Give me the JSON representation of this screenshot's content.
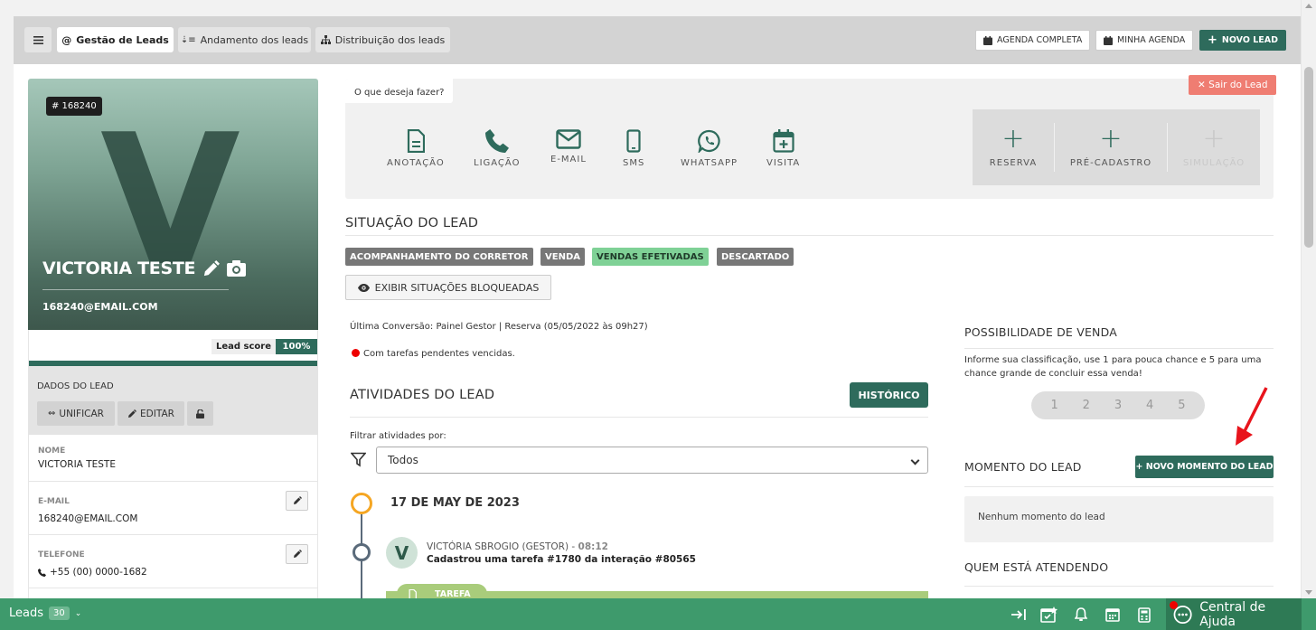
{
  "tabs": [
    {
      "label": "Gestão de Leads",
      "icon": "at-icon"
    },
    {
      "label": "Andamento dos leads",
      "icon": "sort-icon"
    },
    {
      "label": "Distribuição dos leads",
      "icon": "sitemap-icon"
    }
  ],
  "toolbar": {
    "agenda_completa": "AGENDA COMPLETA",
    "minha_agenda": "MINHA AGENDA",
    "novo_lead": "NOVO LEAD"
  },
  "profile": {
    "id_badge": "# 168240",
    "initial": "V",
    "name": "VICTORIA TESTE",
    "email": "168240@EMAIL.COM",
    "lead_score_label": "Lead score",
    "lead_score_value": "100%"
  },
  "dados": {
    "title": "DADOS DO LEAD",
    "unificar": "UNIFICAR",
    "editar": "EDITAR"
  },
  "fields": {
    "nome_label": "NOME",
    "nome_value": "VICTORIA TESTE",
    "email_label": "E-MAIL",
    "email_value": "168240@EMAIL.COM",
    "telefone_label": "TELEFONE",
    "telefone_value": "+55 (00) 0000-1682"
  },
  "actions": {
    "question": "O que deseja fazer?",
    "items": [
      "ANOTAÇÃO",
      "LIGAÇÃO",
      "E-MAIL",
      "SMS",
      "WHATSAPP",
      "VISITA"
    ],
    "right_items": [
      "RESERVA",
      "PRÉ-CADASTRO",
      "SIMULAÇÃO"
    ],
    "sair": "Sair do Lead"
  },
  "situacao": {
    "title": "SITUAÇÃO DO LEAD",
    "tags": [
      "ACOMPANHAMENTO DO CORRETOR",
      "VENDA",
      "VENDAS EFETIVADAS",
      "DESCARTADO"
    ],
    "exibir": "EXIBIR SITUAÇÕES BLOQUEADAS",
    "ultima_conversao": "Última Conversão: Painel Gestor | Reserva (05/05/2022 às 09h27)",
    "pendentes": "Com tarefas pendentes vencidas."
  },
  "atividades": {
    "title": "ATIVIDADES DO LEAD",
    "historico": "HISTÓRICO",
    "filter_label": "Filtrar atividades por:",
    "filter_value": "Todos",
    "date": "17 DE MAY DE 2023",
    "avatar_initial": "V",
    "author": "VICTÓRIA SBROGIO (GESTOR) -",
    "time": "08:12",
    "description": "Cadastrou uma tarefa #1780 da interação #80565",
    "tarefa_label": "TAREFA"
  },
  "possibilidade": {
    "title": "POSSIBILIDADE DE VENDA",
    "description": "Informe sua classificação, use 1 para pouca chance e 5 para uma chance grande de concluir essa venda!",
    "ratings": [
      "1",
      "2",
      "3",
      "4",
      "5"
    ]
  },
  "momento": {
    "title": "MOMENTO DO LEAD",
    "button": "+ NOVO MOMENTO DO LEAD",
    "empty": "Nenhum momento do lead"
  },
  "quem": {
    "title": "QUEM ESTÁ ATENDENDO"
  },
  "bottombar": {
    "leads_label": "Leads",
    "leads_count": "30",
    "help": "Central de Ajuda"
  },
  "colors": {
    "brand": "#2e6b5c",
    "bottom_bar": "#3e9a6c",
    "danger": "#ef7d72"
  }
}
